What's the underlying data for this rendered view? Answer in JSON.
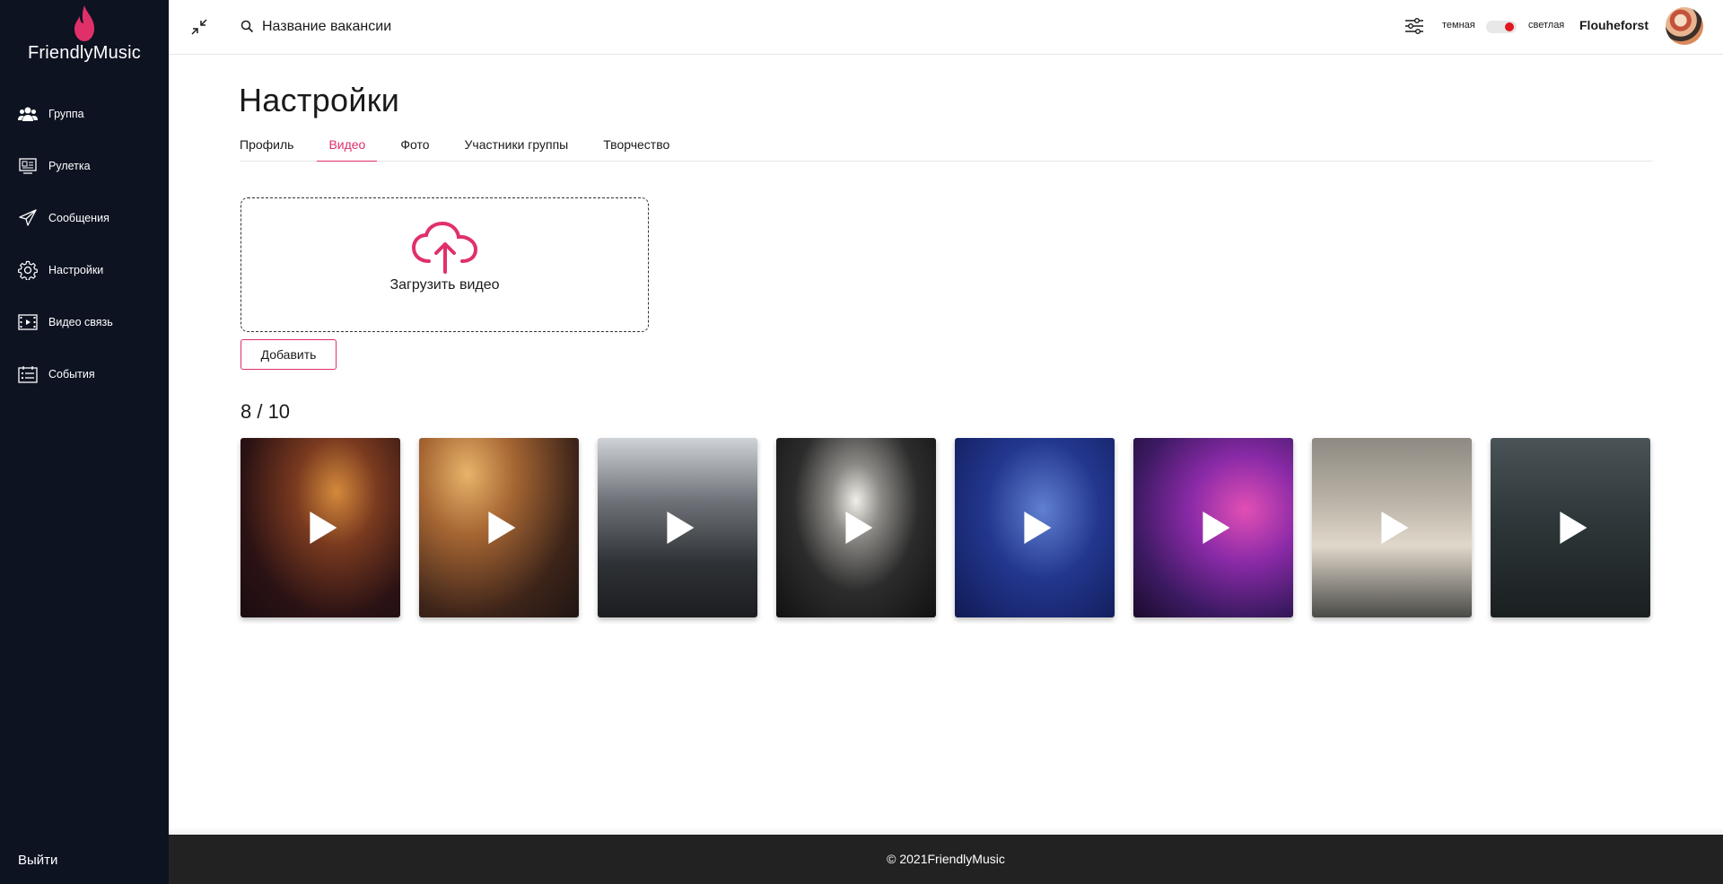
{
  "app": {
    "name": "FriendlyMusic",
    "accent_color": "#e0306a",
    "sidebar_color": "#0e1322"
  },
  "sidebar": {
    "items": [
      {
        "label": "Группа",
        "icon": "users-icon"
      },
      {
        "label": "Рулетка",
        "icon": "roulette-icon"
      },
      {
        "label": "Сообщения",
        "icon": "paper-plane-icon"
      },
      {
        "label": "Настройки",
        "icon": "gear-icon"
      },
      {
        "label": "Видео связь",
        "icon": "film-icon"
      },
      {
        "label": "События",
        "icon": "calendar-list-icon"
      }
    ],
    "logout_label": "Выйти"
  },
  "topbar": {
    "search_value": "Название вакансии",
    "theme_dark_label": "темная",
    "theme_light_label": "светлая",
    "username": "Flouheforst"
  },
  "page": {
    "title": "Настройки",
    "tabs": [
      {
        "label": "Профиль",
        "active": false
      },
      {
        "label": "Видео",
        "active": true
      },
      {
        "label": "Фото",
        "active": false
      },
      {
        "label": "Участники группы",
        "active": false
      },
      {
        "label": "Творчество",
        "active": false
      }
    ],
    "upload_label": "Загрузить видео",
    "add_button_label": "Добавить",
    "video_counter": "8 / 10"
  },
  "videos": [
    {
      "thumb": "concert-crowd-warm"
    },
    {
      "thumb": "concert-hands-orange"
    },
    {
      "thumb": "concert-stage-lights"
    },
    {
      "thumb": "concert-bright-stage"
    },
    {
      "thumb": "violinist-blue-rain"
    },
    {
      "thumb": "phone-recording-purple"
    },
    {
      "thumb": "street-parade"
    },
    {
      "thumb": "band-rehearsal"
    }
  ],
  "footer": {
    "copyright": "© 2021FriendlyMusic"
  }
}
